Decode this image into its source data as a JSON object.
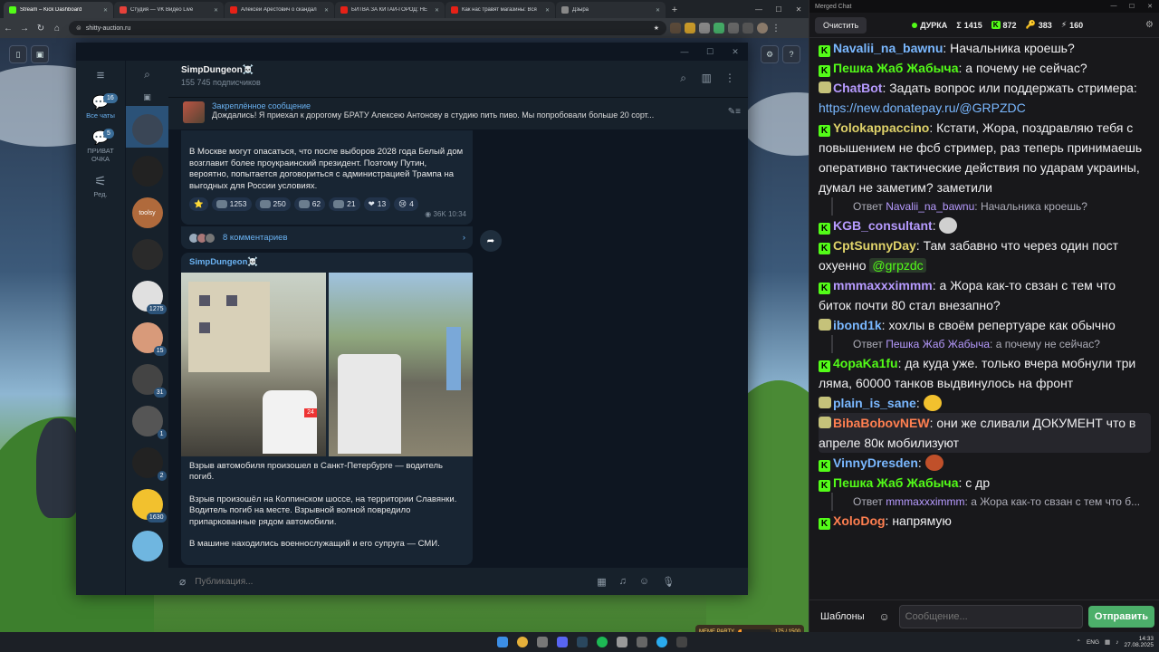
{
  "browser": {
    "tabs": [
      {
        "title": "Stream – Kick Dashboard",
        "color": "#53fc18"
      },
      {
        "title": "Студия — VK Видео Live",
        "color": "#e6413a"
      },
      {
        "title": "Алексей Арестович о скандал",
        "color": "#e62117"
      },
      {
        "title": "БИТВА ЗА КИТАЙ-ГОРОД: НЕ",
        "color": "#e62117"
      },
      {
        "title": "Как нас травят магазины: Вся",
        "color": "#e62117"
      },
      {
        "title": "Дзыра",
        "color": "#888"
      }
    ],
    "new_tab": "+",
    "url": "shitty-auction.ru",
    "controls": {
      "minimize": "—",
      "maximize": "☐",
      "close": "✕"
    }
  },
  "telegram": {
    "folders": [
      {
        "label": "Все чаты",
        "badge": "16",
        "icon": "chat-bubbles-icon"
      },
      {
        "label": "ПРИВАТ ОЧКА",
        "badge": "5",
        "icon": "chat-folder-icon"
      },
      {
        "label": "Ред.",
        "badge": "",
        "icon": "edit-sliders-icon"
      }
    ],
    "chat_counts": [
      "",
      "",
      "",
      "",
      "1275",
      "15",
      "31",
      "1",
      "2",
      "1630",
      ""
    ],
    "chat_avatar_colors": [
      "#3a4656",
      "#222",
      "#b06a3c",
      "#2a2a2a",
      "#e0e0e0",
      "#d89a7a",
      "#444",
      "#555",
      "#222",
      "#f2c12e",
      "#6fb6e0",
      "#ccc"
    ],
    "tile_labels": {
      "toolsy": "toolsy"
    },
    "channel": {
      "name": "SimpDungeon☠️",
      "subscribers": "155 745 подписчиков"
    },
    "pinned": {
      "title": "Закреплённое сообщение",
      "text": "Дождались!  Я приехал к дорогому БРАТУ Алексею Антонову в студию пить пиво. Мы попробовали больше 20 сорт..."
    },
    "post1": {
      "text": "В Москве могут опасаться, что после выборов 2028 года Белый дом возглавит более проукраинский президент. Поэтому Путин, вероятно, попытается договориться с администрацией Трампа на выгодных для России условиях.",
      "reactions": [
        {
          "emoji": "⭐",
          "count": ""
        },
        {
          "emoji": "",
          "count": "1253"
        },
        {
          "emoji": "",
          "count": "250"
        },
        {
          "emoji": "",
          "count": "62"
        },
        {
          "emoji": "",
          "count": "21"
        },
        {
          "emoji": "❤",
          "count": "13"
        },
        {
          "emoji": "😢",
          "count": "4"
        }
      ],
      "views": "36K",
      "time": "10:34",
      "comments": "8 комментариев"
    },
    "post2": {
      "author": "SimpDungeon☠️",
      "p1": "Взрыв автомобиля произошел в Санкт-Петербурге — водитель погиб.",
      "p2": "Взрыв произошёл на Колпинском шоссе, на территории Славянки. Водитель погиб на месте. Взрывной волной повредило припаркованные рядом автомобили.",
      "p3": "В машине находились военнослужащий и его супруга — СМИ.",
      "photo_plate": "24"
    },
    "composer_placeholder": "Публикация..."
  },
  "chat": {
    "window_title": "Merged Chat",
    "clear_label": "Очистить",
    "stream_label": "ДУРКА",
    "stats": [
      {
        "icon": "Σ",
        "value": "1415"
      },
      {
        "icon": "K",
        "value": "872"
      },
      {
        "icon": "🔑",
        "value": "383"
      },
      {
        "icon": "⚡",
        "value": "160"
      }
    ],
    "messages": [
      {
        "platform": "kick",
        "user": "Navalii_na_bawnu",
        "color": "#7ab8ff",
        "text": "Начальника кроешь?"
      },
      {
        "platform": "kick",
        "user": "Пешка Жаб Жабыча",
        "color": "#53fc18",
        "text": "а почему не сейчас?"
      },
      {
        "platform": "bot",
        "user": "ChatBot",
        "color": "#b79bff",
        "text": "Задать вопрос или поддержать стримера: ",
        "link": "https://new.donatepay.ru/@GRPZDC"
      },
      {
        "platform": "kick",
        "user": "Yolokappaccino",
        "color": "#e0d36a",
        "text": "Кстати, Жора, поздравляю тебя с повышением не фсб стример, раз теперь принимаешь оперативно тактические действия по ударам украины, думал не заметим? заметили"
      },
      {
        "reply": true,
        "user": "Navalii_na_bawnu",
        "text": "Начальника кроешь?"
      },
      {
        "platform": "kick",
        "user": "KGB_consultant",
        "color": "#b79bff",
        "text": "",
        "emote": "#d0d0d0"
      },
      {
        "platform": "kick",
        "user": "CptSunnyDay",
        "color": "#e0d36a",
        "text": "Там забавно что через один пост охуенно ",
        "mention": "@grpzdc"
      },
      {
        "platform": "kick",
        "user": "mmmaxxximmm",
        "color": "#b79bff",
        "text": "а Жора как-то свзан с тем что биток почти 80 стал внезапно?"
      },
      {
        "platform": "bot",
        "user": "ibond1k",
        "color": "#7ab8ff",
        "text": "хохлы в своём репертуаре как обычно"
      },
      {
        "reply": true,
        "user": "Пешка Жаб Жабыча",
        "text": "а почему не сейчас?"
      },
      {
        "platform": "kick",
        "user": "4opaKa1fu",
        "color": "#53fc18",
        "text": "да куда уже. только вчера мобнули три ляма, 60000 танков выдвинулось на фронт"
      },
      {
        "platform": "bot",
        "user": "plain_is_sane",
        "color": "#7ab8ff",
        "text": "",
        "emote": "#f2c12e"
      },
      {
        "platform": "bot",
        "user": "BibaBobovNEW",
        "color": "#ff7f50",
        "text": "они же сливали ДОКУМЕНТ что в апреле 80к мобилизуют",
        "highlight": true
      },
      {
        "platform": "kick",
        "user": "VinnyDresden",
        "color": "#7ab8ff",
        "text": "",
        "emote": "#c0502a"
      },
      {
        "platform": "kick",
        "user": "Пешка Жаб Жабыча",
        "color": "#53fc18",
        "text": "с др"
      },
      {
        "reply": true,
        "user": "mmmaxxximmm",
        "text": "а Жора как-то свзан с тем что б..."
      },
      {
        "platform": "kick",
        "user": "XoloDog",
        "color": "#ff7f50",
        "text": "напрямую"
      }
    ],
    "reply_prefix": "Ответ",
    "templates_label": "Шаблоны",
    "input_placeholder": "Сообщение...",
    "send_label": "Отправить"
  },
  "taskbar": {
    "lang": "ENG",
    "time": "14:33",
    "date": "27.08.2025",
    "meme_party": {
      "label": "MEME PARTY",
      "progress_text": "175 / 1500",
      "progress": 0.117
    }
  }
}
